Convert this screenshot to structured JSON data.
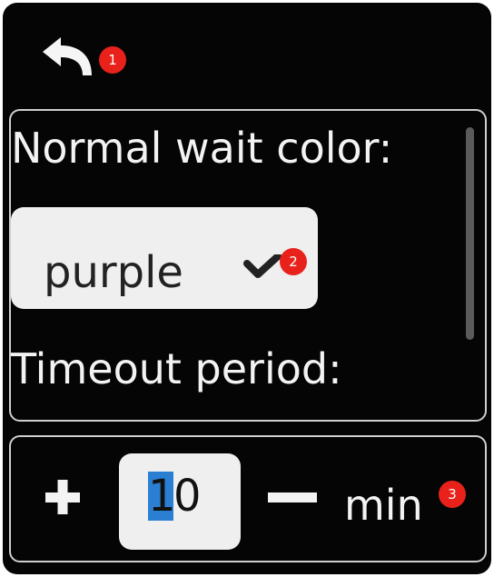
{
  "header": {
    "back_icon": "back-arrow-icon",
    "badge": "1"
  },
  "wait_color": {
    "label": "Normal wait color:",
    "selected": "purple",
    "dropdown_icon": "chevron-down-icon",
    "badge": "2"
  },
  "timeout": {
    "label": "Timeout period:",
    "value_selected": "1",
    "value_rest": "0",
    "increment_icon": "plus-icon",
    "decrement_icon": "minus-icon",
    "unit": "min",
    "badge": "3"
  },
  "colors": {
    "background": "#050505",
    "text": "#f3f3f3",
    "control_bg": "#efefef",
    "selection": "#2b7fd2",
    "badge": "#e8221b"
  }
}
